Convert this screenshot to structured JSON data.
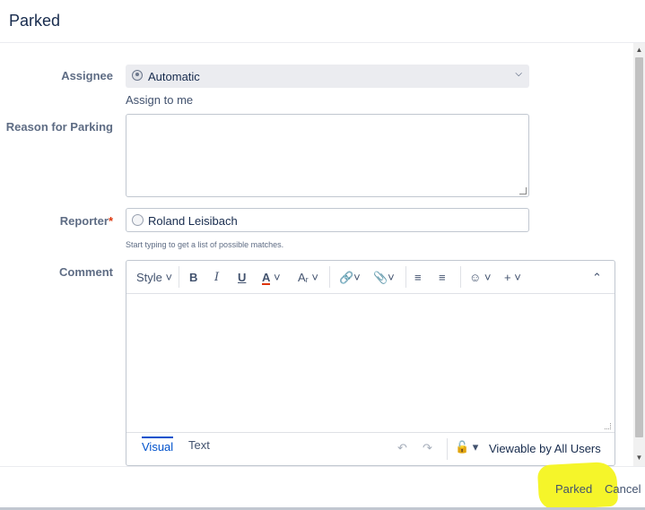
{
  "dialog": {
    "title": "Parked"
  },
  "form": {
    "assignee": {
      "label": "Assignee",
      "value": "Automatic",
      "assign_to_me": "Assign to me"
    },
    "reason": {
      "label": "Reason for Parking",
      "value": ""
    },
    "reporter": {
      "label": "Reporter",
      "required_mark": "*",
      "value": "Roland Leisibach",
      "hint": "Start typing to get a list of possible matches."
    },
    "comment": {
      "label": "Comment",
      "toolbar": {
        "style": "Style",
        "bold": "B",
        "italic": "I",
        "underline": "U",
        "text_color": "A",
        "caret": "⌄"
      },
      "tabs": {
        "visual": "Visual",
        "text": "Text"
      },
      "visibility": "Viewable by All Users"
    }
  },
  "footer": {
    "submit_label": "Parked",
    "cancel_label": "Cancel"
  },
  "colors": {
    "highlight": "#f5f52a",
    "link": "#0052cc",
    "required": "#de350b"
  }
}
